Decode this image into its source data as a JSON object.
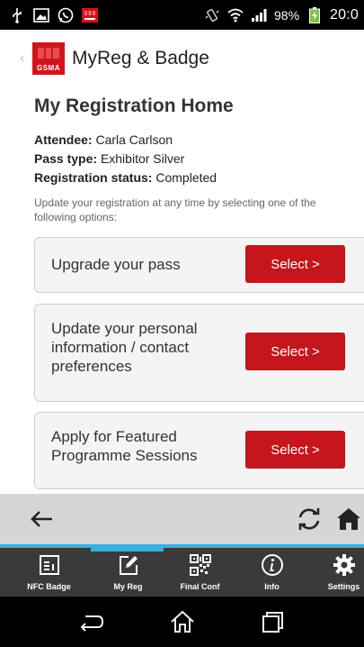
{
  "status_bar": {
    "battery_percent": "98%",
    "time": "20:0",
    "icons": [
      "usb-icon",
      "image-icon",
      "whatsapp-icon",
      "gsma-notification-icon",
      "vibrate-icon",
      "wifi-icon",
      "signal-icon",
      "battery-charging-icon"
    ]
  },
  "header": {
    "title": "MyReg & Badge",
    "logo_text": "GSMA"
  },
  "main": {
    "title": "My Registration Home",
    "attendee_label": "Attendee:",
    "attendee_value": "Carla Carlson",
    "pass_label": "Pass type:",
    "pass_value": "Exhibitor Silver",
    "status_label": "Registration status:",
    "status_value": "Completed",
    "help_text": "Update your registration at any time by selecting one of the following options:",
    "options": [
      {
        "label_lines": [
          "Upgrade your pass"
        ],
        "button": "Select >"
      },
      {
        "label_lines": [
          "Update your personal",
          "information / contact",
          "preferences"
        ],
        "button": "Select >"
      },
      {
        "label_lines": [
          "Apply for Featured",
          "Programme Sessions"
        ],
        "button": "Select >"
      }
    ]
  },
  "browser_toolbar": {
    "icons": [
      "back-arrow-icon",
      "refresh-icon",
      "home-icon"
    ]
  },
  "tabs": [
    {
      "label": "NFC Badge",
      "icon": "badge-icon"
    },
    {
      "label": "My Reg",
      "icon": "edit-icon",
      "active": true
    },
    {
      "label": "Final Conf",
      "icon": "qr-code-icon"
    },
    {
      "label": "Info",
      "icon": "info-icon"
    },
    {
      "label": "Settings",
      "icon": "gear-icon"
    }
  ],
  "nav": {
    "icons": [
      "back-icon",
      "home-icon",
      "recents-icon"
    ]
  },
  "colors": {
    "brand_red": "#c4161c",
    "accent_blue": "#3bb0e0",
    "tab_bar_bg": "#3a3a3a",
    "toolbar_bg": "#d6d6d6"
  }
}
